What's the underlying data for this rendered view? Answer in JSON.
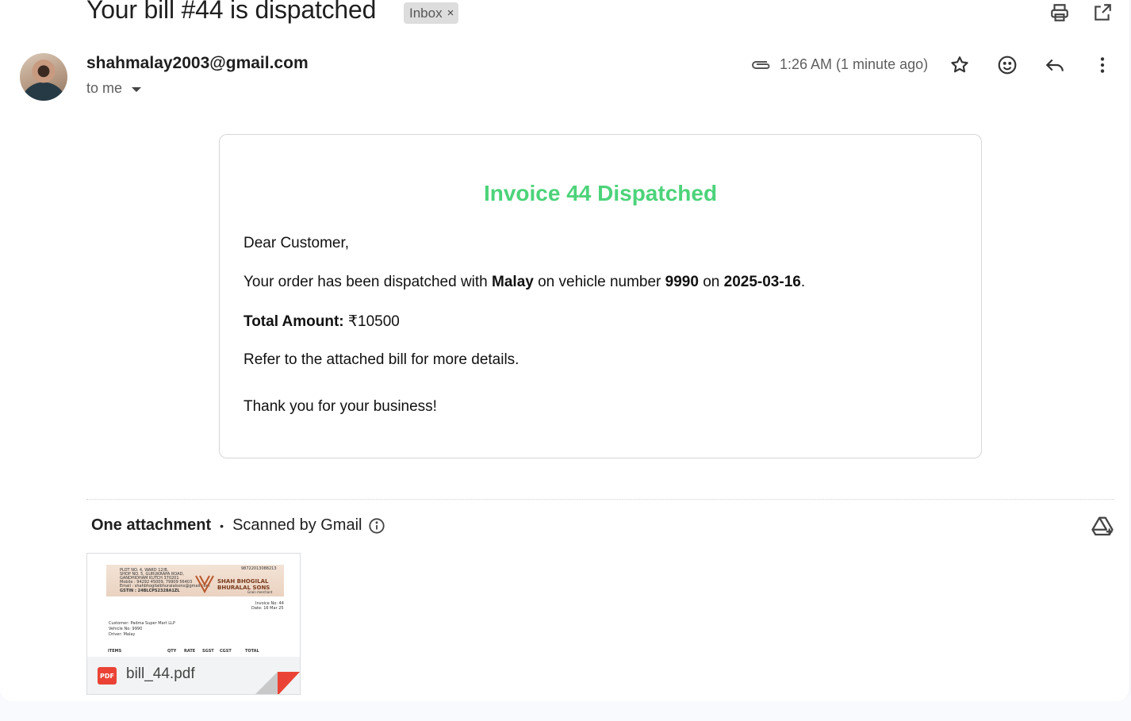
{
  "subject": "Your bill #44 is dispatched",
  "label": {
    "name": "Inbox",
    "remove": "×"
  },
  "header_icons": [
    "printer-icon",
    "open-in-new-window-icon"
  ],
  "sender": {
    "email": "shahmalay2003@gmail.com",
    "recipient": "to me"
  },
  "meta": {
    "time": "1:26 AM (1 minute ago)",
    "icons": [
      "attachment-icon",
      "star-icon",
      "emoji-reaction-icon",
      "reply-icon",
      "more-vert-icon"
    ]
  },
  "body": {
    "title": "Invoice 44 Dispatched",
    "greeting": "Dear Customer,",
    "line_prefix": "Your order has been dispatched with ",
    "driver": "Malay",
    "line_mid1": " on vehicle number ",
    "vehicle": "9990",
    "line_mid2": " on ",
    "date": "2025-03-16",
    "line_end": ".",
    "total_label": "Total Amount:",
    "total_value": " ₹10500",
    "refer": "Refer to the attached bill for more details.",
    "thanks": "Thank you for your business!"
  },
  "attachments": {
    "heading": "One attachment",
    "separator": "•",
    "scanned": "Scanned by Gmail",
    "files": [
      {
        "name": "bill_44.pdf",
        "type": "PDF",
        "preview": {
          "shop_lines": [
            "PLOT NO. 4, WARD 12/B,",
            "SHOP NO. 5, GURUKRAPA ROAD,",
            "GANDHIDHAM KUTCH 370201",
            "Mobile : 94292 45009, 79909 56403",
            "Email : shahbhogilalbhuralalsons@gmail.com"
          ],
          "gstin": "GSTIN : 24BLCPS2328A1ZL",
          "phone_top": "98722013088213",
          "company_line1": "SHAH BHOGILAL",
          "company_line2": "BHURALAL SONS",
          "company_tag": "Grain merchant",
          "invoice_no": "Invoice No: 44",
          "invoice_date": "Date: 16 Mar 25",
          "customer": "Customer: Padma Super Mart LLP",
          "vehicle": "Vehicle No: 9990",
          "driver": "Driver: Malay",
          "columns": [
            "ITEMS",
            "QTY",
            "RATE",
            "SGST",
            "CGST",
            "TOTAL"
          ]
        }
      }
    ]
  },
  "colors": {
    "title_green": "#4cd37a",
    "pdf_red": "#ea4335",
    "label_chip": "#dddddd"
  }
}
